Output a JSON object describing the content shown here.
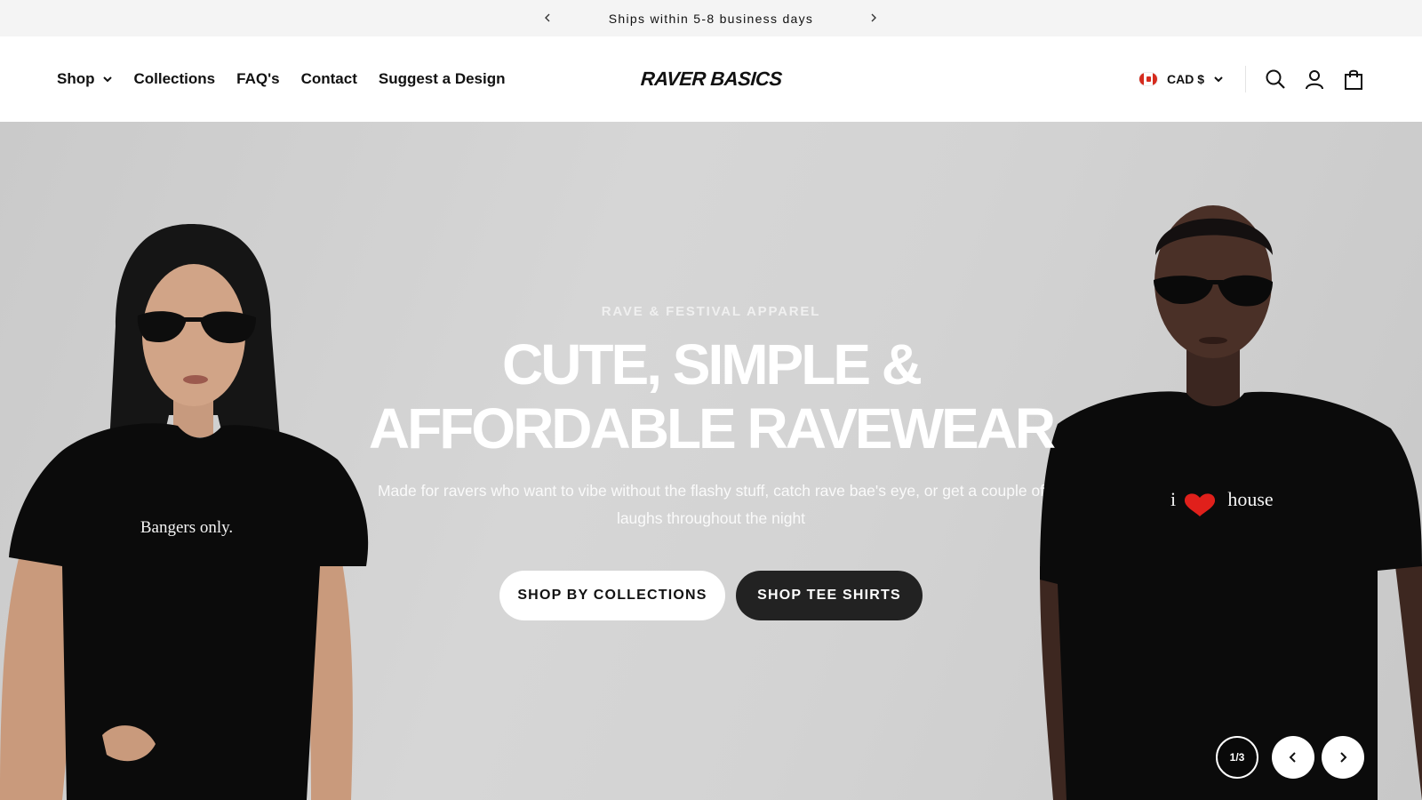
{
  "announcement": {
    "text": "Ships within 5-8 business days",
    "prev_icon": "chevron-left-icon",
    "next_icon": "chevron-right-icon"
  },
  "header": {
    "nav": [
      {
        "label": "Shop",
        "has_dropdown": true
      },
      {
        "label": "Collections"
      },
      {
        "label": "FAQ's"
      },
      {
        "label": "Contact"
      },
      {
        "label": "Suggest a Design"
      }
    ],
    "logo": "RAVER BASICS",
    "currency": "CAD $",
    "icons": [
      "search-icon",
      "account-icon",
      "cart-icon"
    ]
  },
  "hero": {
    "eyebrow": "RAVE & FESTIVAL APPAREL",
    "headline_line1": "CUTE, SIMPLE &",
    "headline_line2": "AFFORDABLE RAVEWEAR",
    "subcopy_line1": "Made for ravers who want to vibe without the flashy stuff, catch rave bae's eye, or get a couple of",
    "subcopy_line2": "laughs throughout the night",
    "buttons": {
      "primary": "SHOP BY COLLECTIONS",
      "secondary": "SHOP TEE SHIRTS"
    },
    "model_left_shirt": "Bangers only.",
    "model_right_shirt_left": "i",
    "model_right_shirt_right": "house",
    "slide_counter": "1/3"
  },
  "colors": {
    "announcement_bg": "#f4f4f4",
    "hero_bg": "#d3d3d3",
    "dark_button": "#222222",
    "heart": "#e0201b"
  }
}
